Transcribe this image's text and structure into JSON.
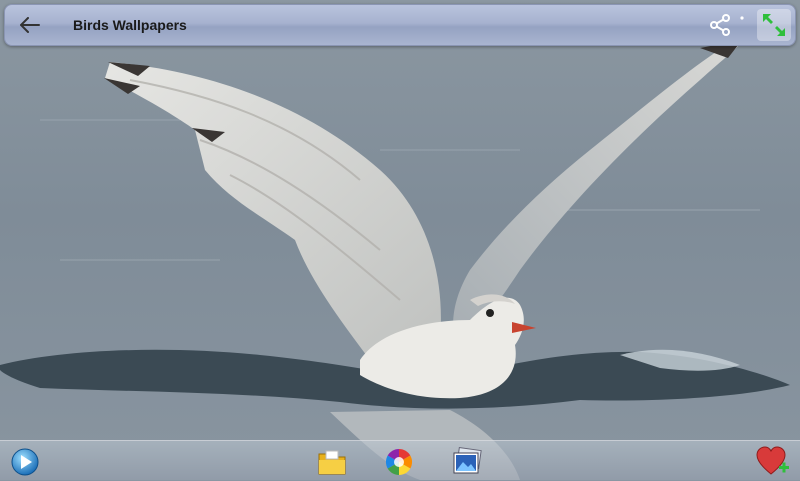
{
  "header": {
    "title": "Birds Wallpapers"
  },
  "icons": {
    "back": "back-arrow-icon",
    "share": "share-icon",
    "fullscreen": "fullscreen-icon",
    "play": "play-icon",
    "folder": "folder-icon",
    "color": "color-wheel-icon",
    "gallery": "gallery-icon",
    "favorite": "favorite-add-icon"
  },
  "colors": {
    "toolbar_bg": "#a7b2cf",
    "accent_green": "#2fbf3c",
    "heart_red": "#d83a3a"
  }
}
